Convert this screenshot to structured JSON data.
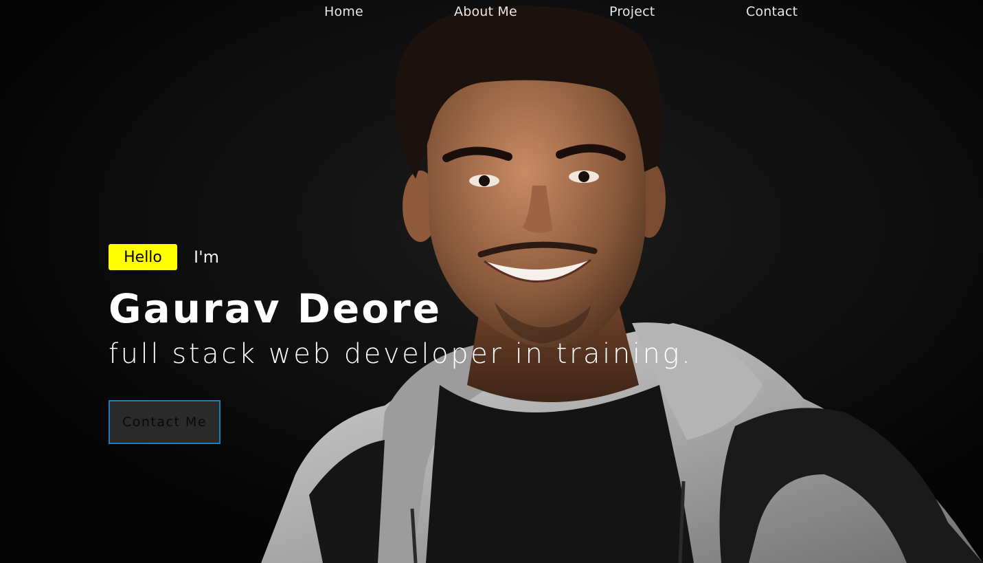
{
  "nav": {
    "items": [
      {
        "label": "Home"
      },
      {
        "label": "About Me"
      },
      {
        "label": "Project"
      },
      {
        "label": "Contact"
      }
    ]
  },
  "hero": {
    "hello_badge": "Hello",
    "im_text": "I'm",
    "name": "Gaurav Deore",
    "role": "full stack web developer in training.",
    "cta_label": "Contact Me"
  },
  "colors": {
    "background": "#0a0a0a",
    "badge": "#ffff00",
    "button_border": "#1a7fb8",
    "hoodie": "#b9b9b9",
    "skin": "#8a5a3c"
  },
  "icons": {
    "portrait": "person-photo"
  }
}
